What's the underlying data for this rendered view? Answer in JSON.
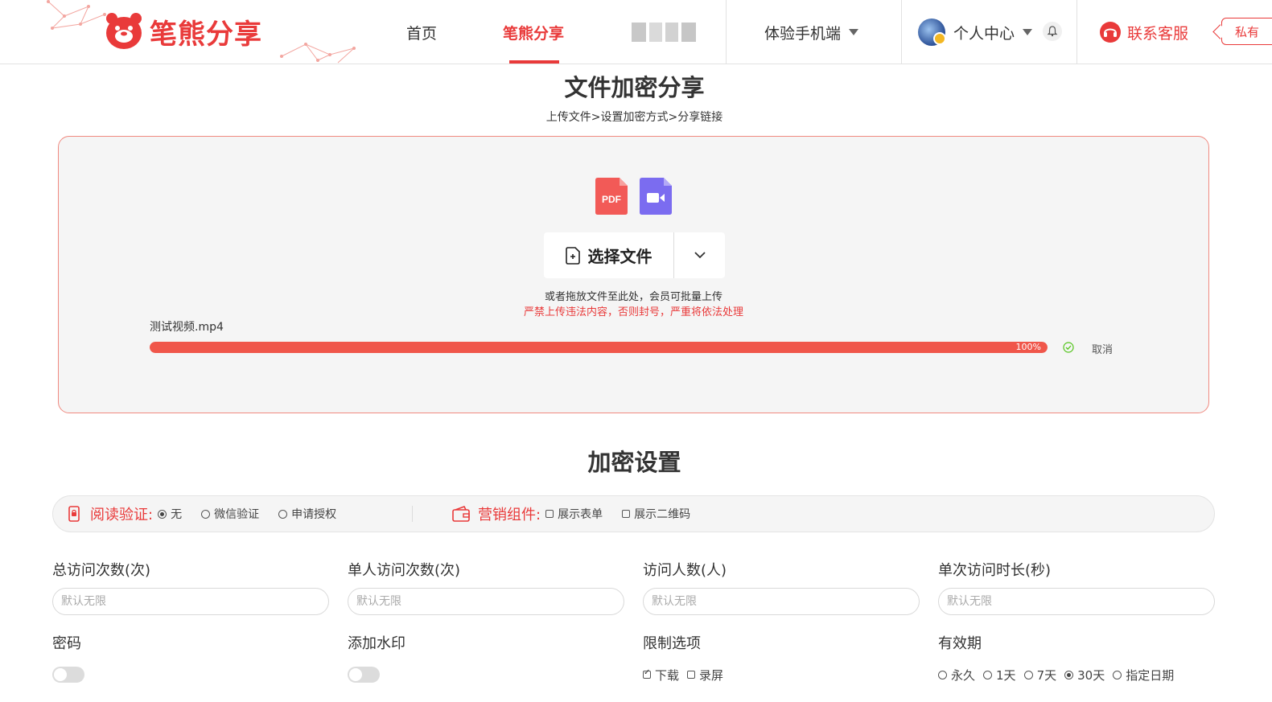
{
  "header": {
    "logo_text": "笔熊分享",
    "nav": {
      "home": "首页",
      "share": "笔熊分享",
      "mobile": "体验手机端",
      "personal": "个人中心",
      "service": "联系客服",
      "private": "私有"
    }
  },
  "page": {
    "title": "文件加密分享",
    "steps": "上传文件>设置加密方式>分享链接"
  },
  "upload": {
    "choose_label": "选择文件",
    "drop_hint": "或者拖放文件至此处，会员可批量上传",
    "warning": "严禁上传违法内容，否则封号，严重将依法处理",
    "file_name": "测试视频.mp4",
    "progress": 1.0,
    "progress_label": "100%",
    "cancel_label": "取消",
    "pdf_icon_text": "PDF"
  },
  "encryption": {
    "section_title": "加密设置",
    "read_verify": {
      "label": "阅读验证:",
      "options": [
        {
          "label": "无",
          "selected": true
        },
        {
          "label": "微信验证",
          "selected": false
        },
        {
          "label": "申请授权",
          "selected": false
        }
      ]
    },
    "marketing": {
      "label": "营销组件:",
      "options": [
        {
          "label": "展示表单",
          "checked": false
        },
        {
          "label": "展示二维码",
          "checked": false
        }
      ]
    },
    "fields": {
      "total_visits": {
        "label": "总访问次数(次)",
        "placeholder": "默认无限"
      },
      "per_person_visits": {
        "label": "单人访问次数(次)",
        "placeholder": "默认无限"
      },
      "visitor_count": {
        "label": "访问人数(人)",
        "placeholder": "默认无限"
      },
      "visit_duration": {
        "label": "单次访问时长(秒)",
        "placeholder": "默认无限"
      }
    },
    "password": {
      "label": "密码",
      "enabled": false
    },
    "watermark": {
      "label": "添加水印",
      "enabled": false
    },
    "restrictions": {
      "label": "限制选项",
      "options": [
        {
          "label": "下载",
          "checked": true
        },
        {
          "label": "录屏",
          "checked": false
        }
      ]
    },
    "validity": {
      "label": "有效期",
      "options": [
        {
          "label": "永久",
          "selected": false
        },
        {
          "label": "1天",
          "selected": false
        },
        {
          "label": "7天",
          "selected": false
        },
        {
          "label": "30天",
          "selected": true
        },
        {
          "label": "指定日期",
          "selected": false
        }
      ]
    }
  },
  "colors": {
    "brand": "#e93a3a",
    "progress": "#f0564a",
    "pdf": "#f25a57",
    "video": "#7b6cf0"
  }
}
